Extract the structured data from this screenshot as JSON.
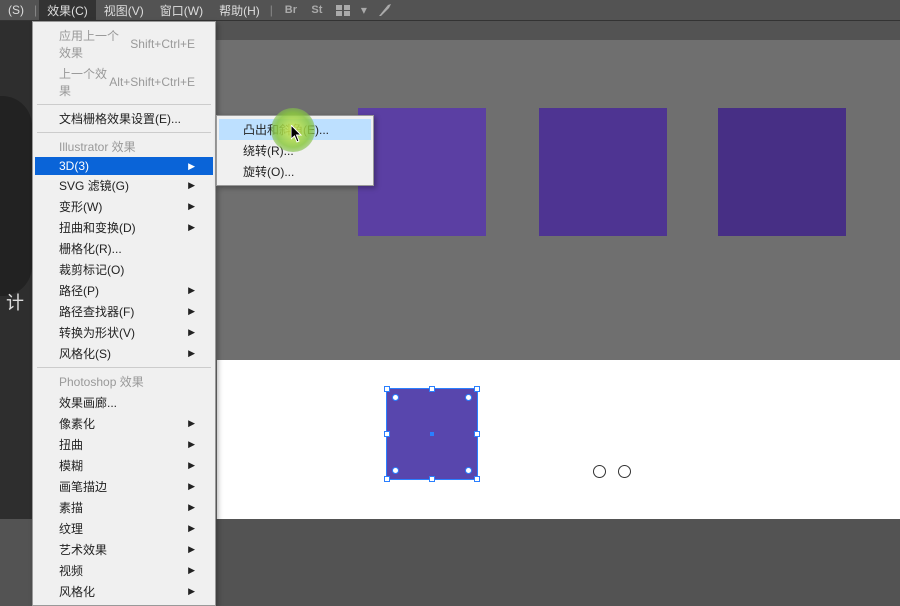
{
  "menubar": {
    "items": [
      "(S)",
      "效果(C)",
      "视图(V)",
      "窗口(W)",
      "帮助(H)"
    ],
    "active_index": 1
  },
  "dropdown": {
    "apply_last": {
      "label": "应用上一个效果",
      "shortcut": "Shift+Ctrl+E"
    },
    "last_effect": {
      "label": "上一个效果",
      "shortcut": "Alt+Shift+Ctrl+E"
    },
    "doc_raster": "文档栅格效果设置(E)...",
    "section_illustrator": "Illustrator 效果",
    "items_ai": [
      {
        "label": "3D(3)",
        "highlighted": true,
        "has_submenu": true
      },
      {
        "label": "SVG 滤镜(G)",
        "has_submenu": true
      },
      {
        "label": "变形(W)",
        "has_submenu": true
      },
      {
        "label": "扭曲和变换(D)",
        "has_submenu": true
      },
      {
        "label": "栅格化(R)..."
      },
      {
        "label": "裁剪标记(O)"
      },
      {
        "label": "路径(P)",
        "has_submenu": true
      },
      {
        "label": "路径查找器(F)",
        "has_submenu": true
      },
      {
        "label": "转换为形状(V)",
        "has_submenu": true
      },
      {
        "label": "风格化(S)",
        "has_submenu": true
      }
    ],
    "section_photoshop": "Photoshop 效果",
    "items_ps": [
      "效果画廊...",
      "像素化",
      "扭曲",
      "模糊",
      "画笔描边",
      "素描",
      "纹理",
      "艺术效果",
      "视频",
      "风格化"
    ]
  },
  "submenu": {
    "items": [
      {
        "label": "凸出和斜角(E)...",
        "hover": true
      },
      {
        "label": "绕转(R)..."
      },
      {
        "label": "旋转(O)..."
      }
    ]
  },
  "left_char": "计",
  "toolbar_icons": [
    "Br",
    "St"
  ]
}
